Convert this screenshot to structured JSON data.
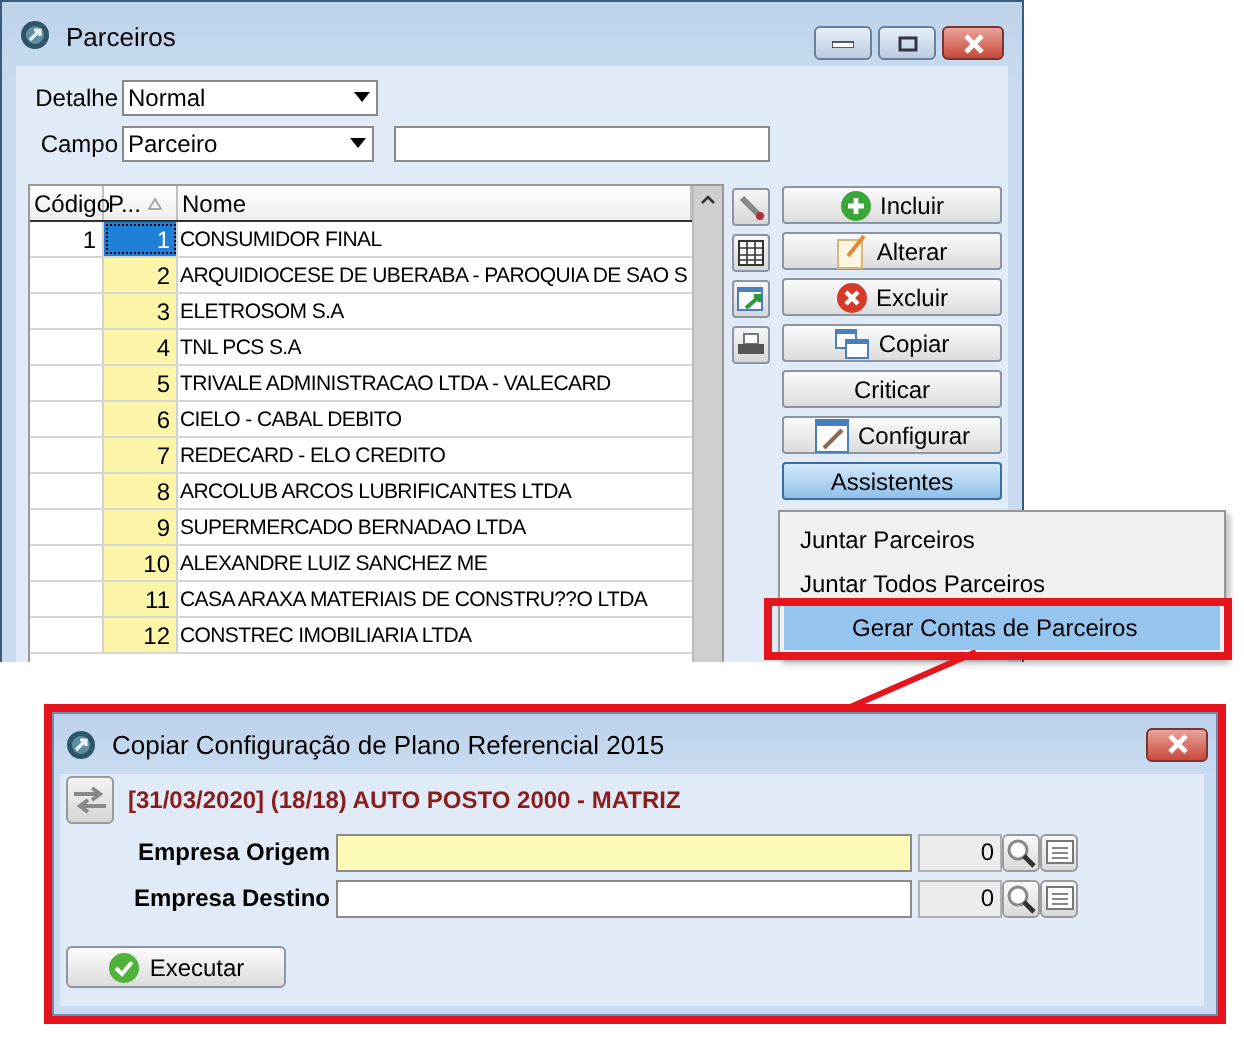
{
  "main_window": {
    "title": "Parceiros"
  },
  "filters": [
    {
      "label": "Detalhe",
      "value": "Normal",
      "kind": "select"
    },
    {
      "label": "Campo",
      "value": "Parceiro",
      "kind": "select"
    }
  ],
  "grid": {
    "columns": [
      "Código",
      "P...",
      "Nome"
    ],
    "rows": [
      {
        "codigo": "1",
        "p": "1",
        "nome": "CONSUMIDOR FINAL",
        "selected": true
      },
      {
        "p": "2",
        "nome": "ARQUIDIOCESE DE UBERABA - PAROQUIA DE SAO S",
        "selected": false
      },
      {
        "p": "3",
        "nome": "ELETROSOM S.A",
        "selected": false
      },
      {
        "p": "4",
        "nome": "TNL PCS S.A",
        "selected": false
      },
      {
        "p": "5",
        "nome": "TRIVALE ADMINISTRACAO LTDA - VALECARD",
        "selected": false
      },
      {
        "p": "6",
        "nome": "CIELO - CABAL DEBITO",
        "selected": false
      },
      {
        "p": "7",
        "nome": "REDECARD - ELO CREDITO",
        "selected": false
      },
      {
        "p": "8",
        "nome": "ARCOLUB ARCOS LUBRIFICANTES LTDA",
        "selected": false
      },
      {
        "p": "9",
        "nome": "SUPERMERCADO BERNADAO LTDA",
        "selected": false
      },
      {
        "p": "10",
        "nome": "ALEXANDRE LUIZ SANCHEZ ME",
        "selected": false
      },
      {
        "p": "11",
        "nome": "CASA ARAXA MATERIAIS DE CONSTRU??O LTDA",
        "selected": false
      },
      {
        "p": "12",
        "nome": "CONSTREC IMOBILIARIA LTDA",
        "selected": false
      }
    ]
  },
  "buttons": [
    {
      "label": "Incluir",
      "expanded": false
    },
    {
      "label": "Alterar",
      "expanded": false
    },
    {
      "label": "Excluir",
      "expanded": false
    },
    {
      "label": "Copiar",
      "expanded": false
    },
    {
      "label": "Criticar",
      "expanded": false
    },
    {
      "label": "Configurar",
      "expanded": false
    },
    {
      "label": "Assistentes",
      "expanded": true
    }
  ],
  "menu": {
    "items": [
      {
        "label": "Juntar Parceiros",
        "selected": false,
        "annotated": false
      },
      {
        "label": "Juntar Todos Parceiros",
        "selected": false,
        "annotated": false
      },
      {
        "label": "Gerar Contas de Parceiros",
        "selected": true,
        "annotated": true
      }
    ]
  },
  "dialog": {
    "title": "Copiar Configuração de Plano Referencial 2015",
    "annotated": true,
    "context": "[31/03/2020] (18/18) AUTO POSTO 2000 - MATRIZ",
    "fields": [
      {
        "label": "Empresa Origem",
        "code": "0",
        "focused": true
      },
      {
        "label": "Empresa Destino",
        "code": "0",
        "focused": false
      }
    ],
    "button": "Executar"
  }
}
